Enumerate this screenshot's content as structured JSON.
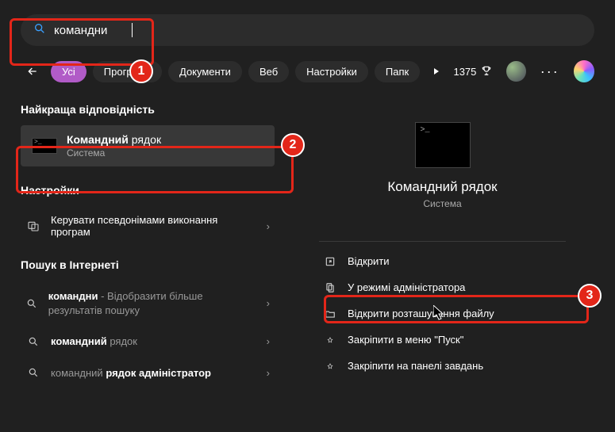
{
  "search": {
    "value": "командни"
  },
  "filters": {
    "all": "Усі",
    "apps": "Програми",
    "docs": "Документи",
    "web": "Веб",
    "settings": "Настройки",
    "folders": "Папк"
  },
  "rewards": {
    "points": "1375"
  },
  "left": {
    "best_match_header": "Найкраща відповідність",
    "best_match": {
      "title_bold": "Командний",
      "title_rest": " рядок",
      "subtitle": "Система"
    },
    "settings_header": "Настройки",
    "settings_item": "Керувати псевдонімами виконання програм",
    "internet_header": "Пошук в Інтернеті",
    "net": [
      {
        "bold": "командни",
        "rest": " - Відобразити більше результатів пошуку"
      },
      {
        "bold": "командний",
        "rest": " рядок"
      },
      {
        "bold1": "командний ",
        "bold2": "рядок адміністратор",
        "mid": ""
      }
    ]
  },
  "right": {
    "title": "Командний рядок",
    "subtitle": "Система",
    "actions": {
      "open": "Відкрити",
      "admin": "У режимі адміністратора",
      "location": "Відкрити розташування файлу",
      "pin_start": "Закріпити в меню \"Пуск\"",
      "pin_taskbar": "Закріпити на панелі завдань"
    }
  },
  "annotations": {
    "b1": "1",
    "b2": "2",
    "b3": "3"
  }
}
